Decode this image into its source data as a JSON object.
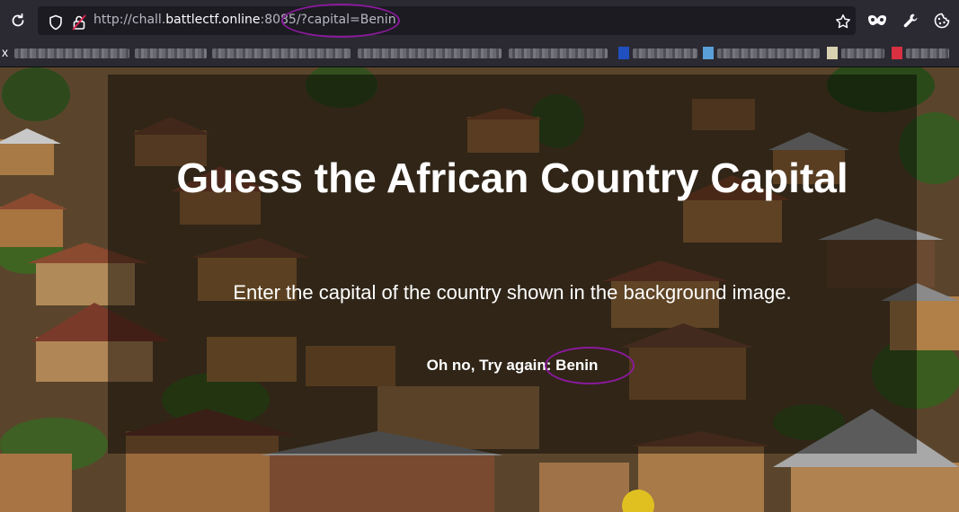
{
  "browser": {
    "url": {
      "scheme": "http://chall.",
      "host": "battlectf.online",
      "port_path": ":8085/?capital=Benin"
    },
    "bookmarks_prefix": "x"
  },
  "page": {
    "title": "Guess the African Country Capital",
    "subtitle": "Enter the capital of the country shown in the background image.",
    "result": "Oh no, Try again: Benin"
  },
  "colors": {
    "annotation": "#8a1a9b",
    "overlay": "rgba(0,0,0,0.46)"
  },
  "icons": [
    "reload-icon",
    "shield-icon",
    "insecure-lock-icon",
    "bookmark-star-icon",
    "mask-icon",
    "wrench-icon",
    "cookie-icon"
  ]
}
